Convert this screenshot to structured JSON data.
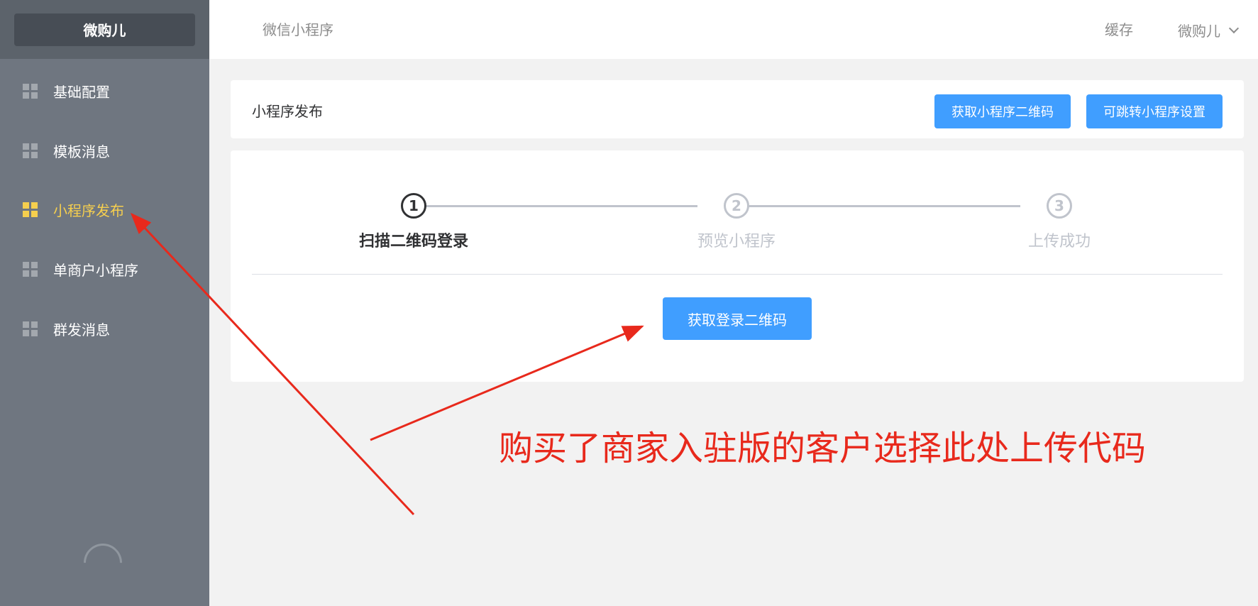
{
  "sidebar": {
    "logo": "微购儿",
    "items": [
      {
        "label": "基础配置",
        "active": false
      },
      {
        "label": "模板消息",
        "active": false
      },
      {
        "label": "小程序发布",
        "active": true
      },
      {
        "label": "单商户小程序",
        "active": false
      },
      {
        "label": "群发消息",
        "active": false
      }
    ]
  },
  "header": {
    "breadcrumb": "微信小程序",
    "cache_label": "缓存",
    "user_name": "微购儿"
  },
  "card": {
    "title": "小程序发布",
    "btn_qrcode": "获取小程序二维码",
    "btn_jump_settings": "可跳转小程序设置"
  },
  "steps": [
    {
      "number": "1",
      "label": "扫描二维码登录",
      "status": "active"
    },
    {
      "number": "2",
      "label": "预览小程序",
      "status": "wait"
    },
    {
      "number": "3",
      "label": "上传成功",
      "status": "wait"
    }
  ],
  "login_button": "获取登录二维码",
  "annotation": {
    "text": "购买了商家入驻版的客户选择此处上传代码",
    "color": "#e8291c"
  },
  "colors": {
    "primary": "#409eff",
    "sidebar_bg": "#6f7680",
    "active_menu": "#f6cf4e"
  }
}
